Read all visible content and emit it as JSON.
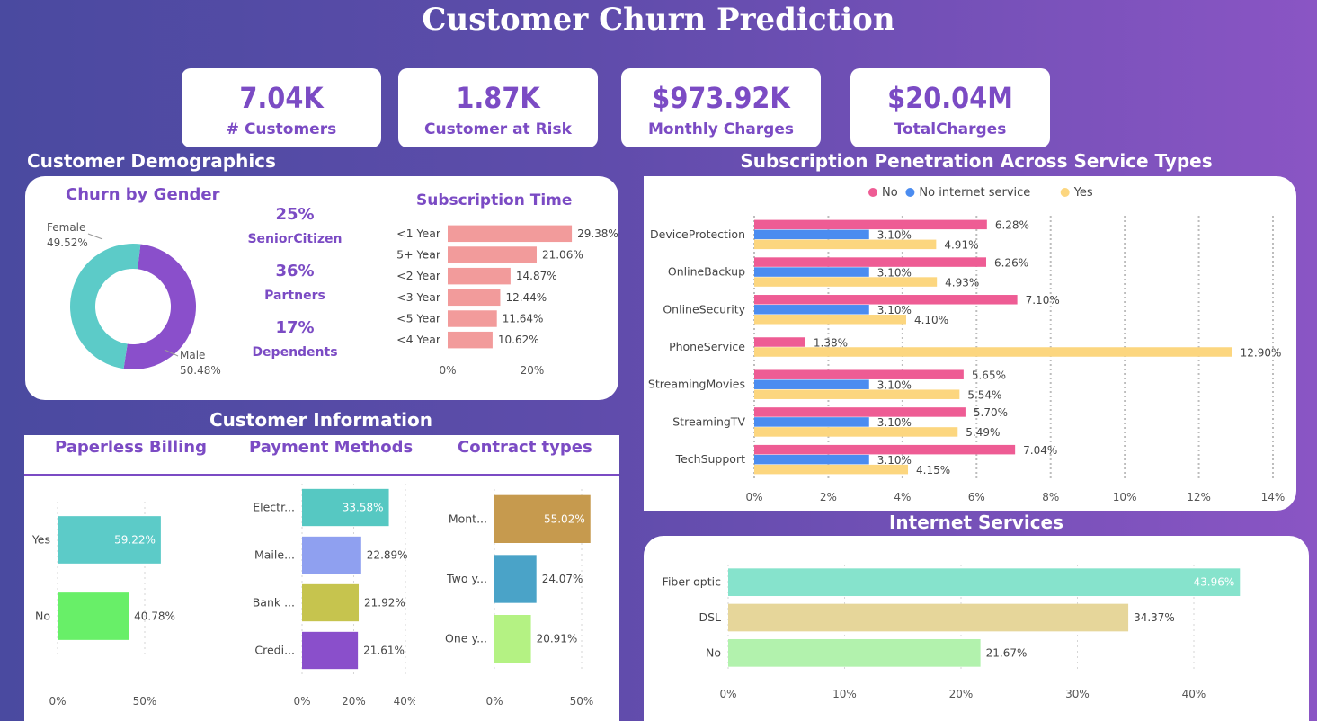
{
  "title": "Customer Churn Prediction",
  "kpis": [
    {
      "value": "7.04K",
      "label": "# Customers"
    },
    {
      "value": "1.87K",
      "label": "Customer at Risk"
    },
    {
      "value": "$973.92K",
      "label": "Monthly Charges"
    },
    {
      "value": "$20.04M",
      "label": "TotalCharges"
    }
  ],
  "sections": {
    "demographics": "Customer Demographics",
    "subscription": "Subscription Penetration Across Service Types",
    "information": "Customer Information",
    "internet": "Internet Services"
  },
  "gender": {
    "title": "Churn by Gender",
    "female_label": "Female",
    "female_pct": "49.52%",
    "male_label": "Male",
    "male_pct": "50.48%",
    "female_value": 49.52,
    "male_value": 50.48,
    "female_color": "#5ccbc8",
    "male_color": "#8a4fcb"
  },
  "stats": [
    {
      "value": "25%",
      "label": "SeniorCitizen"
    },
    {
      "value": "36%",
      "label": "Partners"
    },
    {
      "value": "17%",
      "label": "Dependents"
    }
  ],
  "chart_data": [
    {
      "id": "subscription_time",
      "type": "bar",
      "orientation": "horizontal",
      "title": "Subscription Time",
      "categories": [
        "<1 Year",
        "5+ Year",
        "<2 Year",
        "<3 Year",
        "<5 Year",
        "<4 Year"
      ],
      "values": [
        29.38,
        21.06,
        14.87,
        12.44,
        11.64,
        10.62
      ],
      "labels": [
        "29.38%",
        "21.06%",
        "14.87%",
        "12.44%",
        "11.64%",
        "10.62%"
      ],
      "xticks": [
        "0%",
        "20%"
      ],
      "color": "#f29b9b"
    },
    {
      "id": "subscription_penetration",
      "type": "bar",
      "orientation": "horizontal",
      "title": "Subscription Penetration Across Service Types",
      "categories": [
        "DeviceProtection",
        "OnlineBackup",
        "OnlineSecurity",
        "PhoneService",
        "StreamingMovies",
        "StreamingTV",
        "TechSupport"
      ],
      "series": [
        {
          "name": "No",
          "color": "#ee5c94",
          "values": [
            6.28,
            6.26,
            7.1,
            1.38,
            5.65,
            5.7,
            7.04
          ]
        },
        {
          "name": "No internet service",
          "color": "#4b8cf0",
          "values": [
            3.1,
            3.1,
            3.1,
            null,
            3.1,
            3.1,
            3.1
          ]
        },
        {
          "name": "Yes",
          "color": "#fcd67f",
          "values": [
            4.91,
            4.93,
            4.1,
            12.9,
            5.54,
            5.49,
            4.15
          ]
        }
      ],
      "xticks": [
        "0%",
        "2%",
        "4%",
        "6%",
        "8%",
        "10%",
        "12%",
        "14%"
      ],
      "xlim": [
        0,
        14
      ],
      "legend": "top"
    },
    {
      "id": "paperless_billing",
      "type": "bar",
      "orientation": "horizontal",
      "title": "Paperless Billing",
      "categories": [
        "Yes",
        "No"
      ],
      "values": [
        59.22,
        40.78
      ],
      "labels": [
        "59.22%",
        "40.78%"
      ],
      "colors": [
        "#5ccbc8",
        "#68ef68"
      ],
      "xticks": [
        "0%",
        "50%"
      ]
    },
    {
      "id": "payment_methods",
      "type": "bar",
      "orientation": "horizontal",
      "title": "Payment Methods",
      "categories": [
        "Electr...",
        "Maile...",
        "Bank ...",
        "Credi..."
      ],
      "values": [
        33.58,
        22.89,
        21.92,
        21.61
      ],
      "labels": [
        "33.58%",
        "22.89%",
        "21.92%",
        "21.61%"
      ],
      "colors": [
        "#56c8c2",
        "#8fa0f0",
        "#c6c44e",
        "#8a4fcb"
      ],
      "xticks": [
        "0%",
        "20%",
        "40%"
      ]
    },
    {
      "id": "contract_types",
      "type": "bar",
      "orientation": "horizontal",
      "title": "Contract types",
      "categories": [
        "Mont...",
        "Two y...",
        "One y..."
      ],
      "values": [
        55.02,
        24.07,
        20.91
      ],
      "labels": [
        "55.02%",
        "24.07%",
        "20.91%"
      ],
      "colors": [
        "#c69a4e",
        "#4aa3c8",
        "#b4f283"
      ],
      "xticks": [
        "0%",
        "50%"
      ]
    },
    {
      "id": "internet_services",
      "type": "bar",
      "orientation": "horizontal",
      "title": "Internet Services",
      "categories": [
        "Fiber optic",
        "DSL",
        "No"
      ],
      "values": [
        43.96,
        34.37,
        21.67
      ],
      "labels": [
        "43.96%",
        "34.37%",
        "21.67%"
      ],
      "colors": [
        "#86e3cc",
        "#e6d69a",
        "#b2f2ad"
      ],
      "xticks": [
        "0%",
        "10%",
        "20%",
        "30%",
        "40%"
      ]
    }
  ]
}
